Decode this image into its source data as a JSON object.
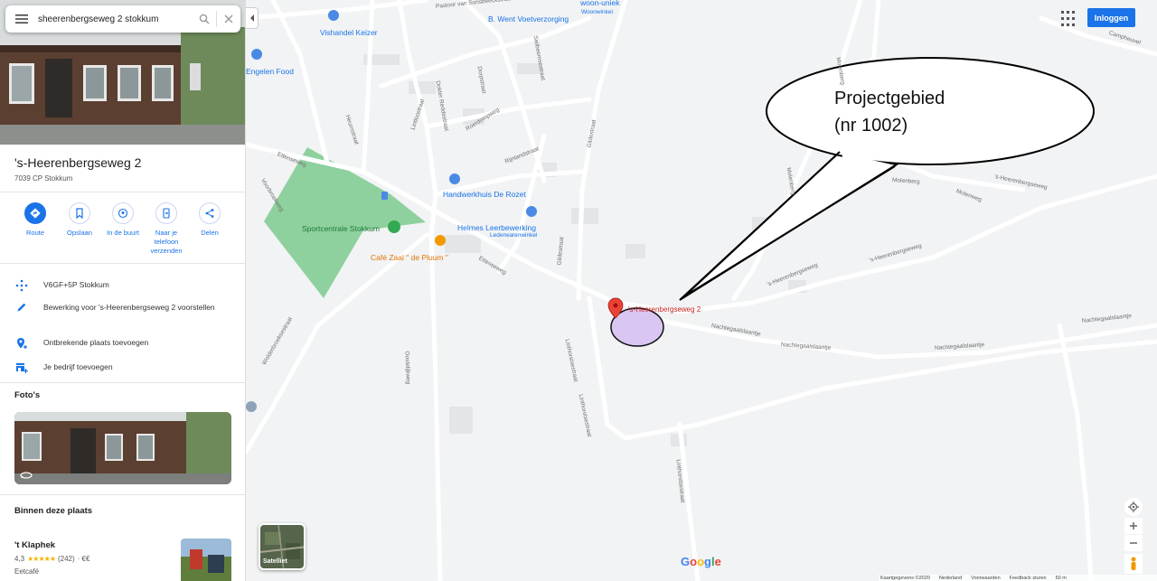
{
  "search": {
    "query": "sheerenbergseweg 2 stokkum"
  },
  "place": {
    "title": "'s-Heerenbergseweg 2",
    "address": "7039 CP Stokkum"
  },
  "actions": [
    {
      "label": "Route"
    },
    {
      "label": "Opslaan"
    },
    {
      "label": "In de buurt"
    },
    {
      "label": "Naar je telefoon verzenden"
    },
    {
      "label": "Delen"
    }
  ],
  "info": {
    "pluscode": "V6GF+5P Stokkum",
    "suggest_edit": "Bewerking voor 's-Heerenbergseweg 2 voorstellen",
    "add_missing": "Ontbrekende plaats toevoegen",
    "add_business": "Je bedrijf toevoegen"
  },
  "photos_heading": "Foto's",
  "within_heading": "Binnen deze plaats",
  "business": {
    "name": "'t Klaphek",
    "rating": "4,3",
    "stars": "★★★★★",
    "reviews": "(242)",
    "price": "· €€",
    "type": "Eetcafé"
  },
  "map": {
    "pois": {
      "vishandel": "Vishandel Keizer",
      "went": "B. Went Voetverzorging",
      "woonuniek": "woon-uniek",
      "woonwinkel": "Woonwinkel",
      "engelen": "Engelen Food",
      "sportcentrale": "Sportcentrale Stokkum",
      "handwerkhuis": "Handwerkhuis De Rozet",
      "helmes": "Helmes Leerbewerking",
      "lederwaren": "Lederwarenwinkel",
      "cafe": "Café Zaal \" de Pluum \"",
      "pin_label": "'s-Heerenbergseweg 2"
    },
    "streets": {
      "pastoor": "Pastoor van Sonsbeeckstraat",
      "dokter": "Dokter Reddestraat",
      "dorpstraat": "Dorpstraat",
      "heurnstraat": "Heurnstraat",
      "lintloostraat": "Lintloostraat",
      "roerdomp": "Roerdompweg",
      "rijnland": "Rijnlandstraat",
      "gildestraat": "Gildestraat",
      "gildestraat2": "Gildestraat",
      "ettenseweg": "Ettenseweg",
      "ettenseweg2": "Ettenseweg",
      "voorbroekweg": "Voorbroekweg",
      "wolderbroeksestraat": "Wolderbroeksestraat",
      "oostelijkweg": "Oostelijkweg",
      "linthorstsestraat": "Linthorstsestraat",
      "linthorstsestraat2": "Linthorstsestraat",
      "linthorstsestraat3": "Linthorstsestraat",
      "molenberg": "Molenberg",
      "molenberg2": "Molenberg",
      "molenberg3": "Molenberg",
      "molenweg": "Molenweg",
      "heerenbergseweg": "'s-Heerenbergseweg",
      "heerenbergseweg2": "'s-Heerenbergseweg",
      "heerenbergseweg3": "'s-Heerenbergseweg",
      "nachtegaal1": "Nachtegaalslaantje",
      "nachtegaal2": "Nachtegaalslaantje",
      "nachtegaal3": "Nachtegaalslaantje",
      "nachtegaal4": "Nachtegaalslaantje",
      "nachtegaal5": "Nachtegaalslaantje",
      "campheuvel": "Campheuvel",
      "fielstraat": "Sielbeemsestraat"
    },
    "callout": {
      "line1": "Projectgebied",
      "line2": "(nr 1002)"
    },
    "login": "Inloggen",
    "satellite": "Satelliet",
    "google": "Google",
    "footer": {
      "data": "Kaartgegevens ©2020",
      "country": "Nederland",
      "terms": "Voorwaarden",
      "feedback": "Feedback sturen",
      "scale": "50 m"
    }
  },
  "colors": {
    "accent": "#1a73e8",
    "park": "#8fd19e",
    "pin": "#ea4335",
    "highlight": "#d9c6f2",
    "poi_orange": "#e37400"
  }
}
